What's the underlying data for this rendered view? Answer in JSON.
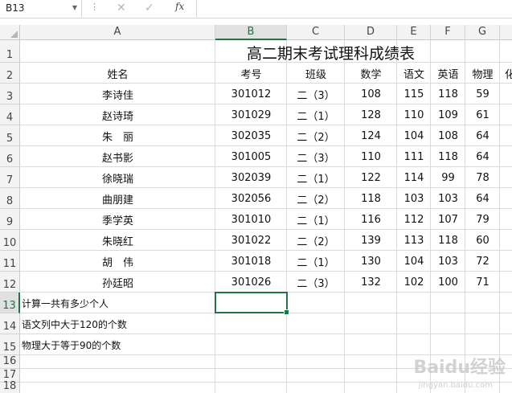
{
  "formula_bar": {
    "name_box": "B13",
    "fx_label": "fx",
    "formula": ""
  },
  "sheet": {
    "columns": [
      "A",
      "B",
      "C",
      "D",
      "E",
      "F",
      "G"
    ],
    "rows": [
      "1",
      "2",
      "3",
      "4",
      "5",
      "6",
      "7",
      "8",
      "9",
      "10",
      "11",
      "12",
      "13",
      "14",
      "15",
      "16",
      "17",
      "18"
    ],
    "title": "高二期末考试理科成绩表",
    "headers": [
      "姓名",
      "考号",
      "班级",
      "数学",
      "语文",
      "英语",
      "物理",
      "化"
    ],
    "data": [
      [
        "李诗佳",
        "301012",
        "二（3）",
        "108",
        "115",
        "118",
        "59"
      ],
      [
        "赵诗琦",
        "301029",
        "二（1）",
        "128",
        "110",
        "109",
        "61"
      ],
      [
        "朱　丽",
        "302035",
        "二（2）",
        "124",
        "104",
        "108",
        "64"
      ],
      [
        "赵书影",
        "301005",
        "二（3）",
        "110",
        "111",
        "118",
        "64"
      ],
      [
        "徐晓瑞",
        "302039",
        "二（1）",
        "122",
        "114",
        "99",
        "78"
      ],
      [
        "曲朋建",
        "302056",
        "二（2）",
        "118",
        "103",
        "103",
        "64"
      ],
      [
        "季学英",
        "301010",
        "二（1）",
        "116",
        "112",
        "107",
        "79"
      ],
      [
        "朱晓红",
        "301022",
        "二（2）",
        "139",
        "113",
        "118",
        "60"
      ],
      [
        "胡　伟",
        "301018",
        "二（1）",
        "130",
        "104",
        "103",
        "72"
      ],
      [
        "孙廷昭",
        "301026",
        "二（3）",
        "132",
        "102",
        "100",
        "71"
      ]
    ],
    "questions": [
      "计算一共有多少个人",
      "语文列中大于120的个数",
      "物理大于等于90的个数"
    ],
    "selected_cell": "B13"
  },
  "watermark": {
    "brand": "Baidu经验",
    "url": "jingyan.baidu.com"
  }
}
